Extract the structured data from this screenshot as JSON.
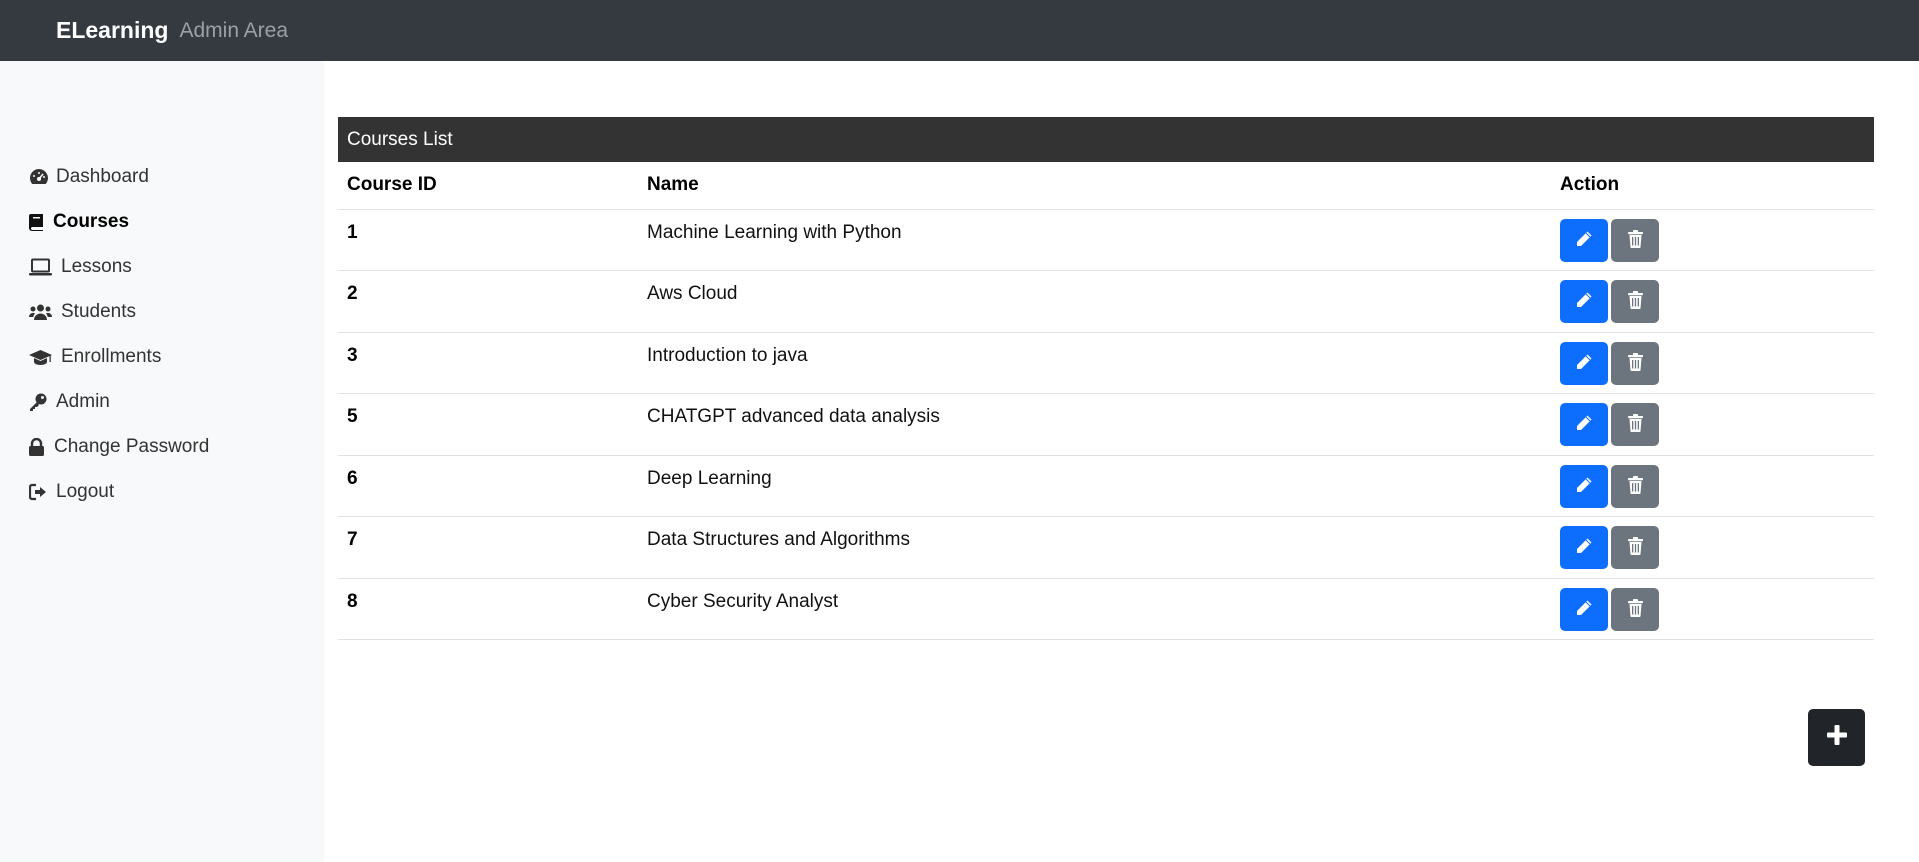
{
  "header": {
    "brand": "ELearning",
    "subtitle": "Admin Area"
  },
  "sidebar": {
    "items": [
      {
        "label": "Dashboard",
        "icon": "gauge-icon"
      },
      {
        "label": "Courses",
        "icon": "book-icon",
        "active": true
      },
      {
        "label": "Lessons",
        "icon": "laptop-icon"
      },
      {
        "label": "Students",
        "icon": "users-icon"
      },
      {
        "label": "Enrollments",
        "icon": "graduation-cap-icon"
      },
      {
        "label": "Admin",
        "icon": "key-icon"
      },
      {
        "label": "Change Password",
        "icon": "lock-icon"
      },
      {
        "label": "Logout",
        "icon": "logout-icon"
      }
    ]
  },
  "courses": {
    "title": "Courses List",
    "columns": [
      "Course ID",
      "Name",
      "Action"
    ],
    "rows": [
      {
        "id": "1",
        "name": "Machine Learning with Python"
      },
      {
        "id": "2",
        "name": "Aws Cloud"
      },
      {
        "id": "3",
        "name": "Introduction to java"
      },
      {
        "id": "5",
        "name": "CHATGPT advanced data analysis"
      },
      {
        "id": "6",
        "name": "Deep Learning"
      },
      {
        "id": "7",
        "name": "Data Structures and Algorithms"
      },
      {
        "id": "8",
        "name": "Cyber Security Analyst"
      }
    ]
  },
  "colors": {
    "topbar": "#343a40",
    "edit_button": "#0d6efd",
    "delete_button": "#6c757d",
    "add_button": "#212529"
  },
  "add_button_icon": "plus-icon"
}
